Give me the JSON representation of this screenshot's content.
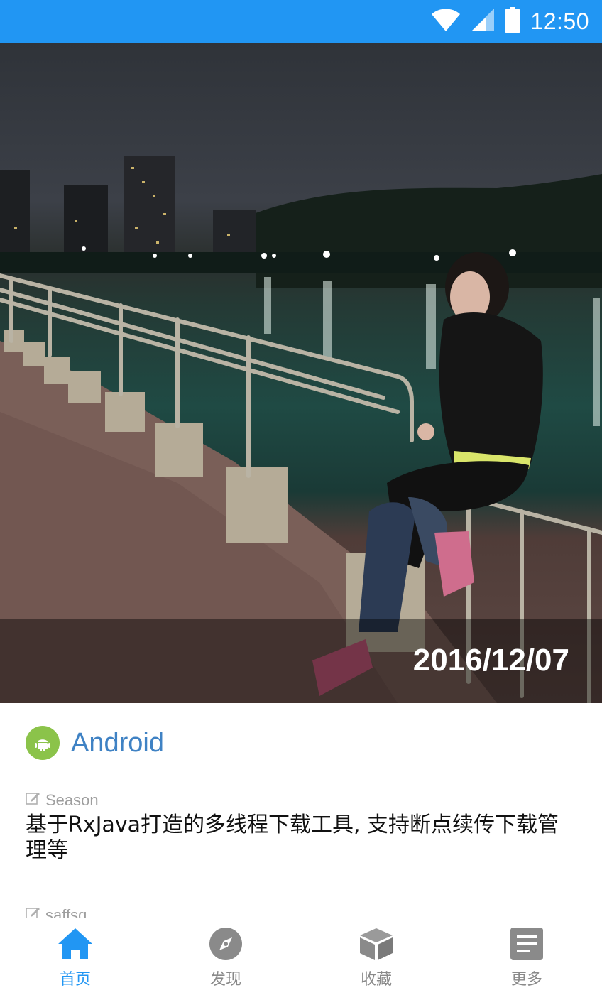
{
  "status_bar": {
    "time": "12:50",
    "icons": [
      "wifi-icon",
      "signal-icon",
      "battery-icon"
    ],
    "background": "#2196f3"
  },
  "hero": {
    "date": "2016/12/07"
  },
  "category": {
    "label": "Android",
    "icon": "android-icon",
    "icon_color": "#8bc34a",
    "label_color": "#3f82c4"
  },
  "articles": [
    {
      "author": "Season",
      "title": "基于RxJava打造的多线程下载工具, 支持断点续传下载管理等"
    },
    {
      "author": "saffsg",
      "title": ""
    }
  ],
  "bottom_nav": {
    "active_color": "#2196f3",
    "items": [
      {
        "label": "首页",
        "icon": "home-icon",
        "active": true
      },
      {
        "label": "发现",
        "icon": "compass-icon",
        "active": false
      },
      {
        "label": "收藏",
        "icon": "box-icon",
        "active": false
      },
      {
        "label": "更多",
        "icon": "more-document-icon",
        "active": false
      }
    ]
  }
}
